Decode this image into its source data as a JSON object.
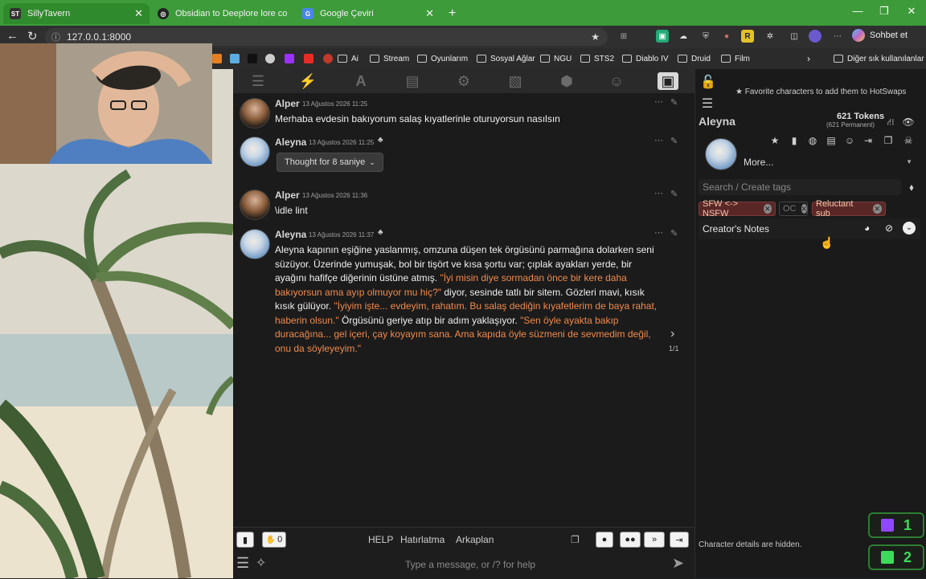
{
  "browser": {
    "tabs": [
      {
        "title": "SillyTavern",
        "favicon": "ST",
        "active": true
      },
      {
        "title": "Obsidian to Deeplore lore convers",
        "favicon": "",
        "active": false
      },
      {
        "title": "Google Çeviri",
        "favicon": "",
        "active": false
      }
    ],
    "url": "127.0.0.1:8000",
    "copilot_label": "Sohbet et",
    "bookmarks": [
      "Ai",
      "Stream",
      "Oyunlarım",
      "Sosyal Ağlar",
      "NGU",
      "STS2",
      "Diablo IV",
      "Druid",
      "Film"
    ],
    "other_bookmarks": "Diğer sık kullanılanlar"
  },
  "chat": {
    "messages": [
      {
        "name": "Alper",
        "time": "13 Ağustos 2026 11:25",
        "text": "Merhaba evdesin bakıyorum salaş kıyatlerinle oturuyorsun nasılsın",
        "ai": false
      },
      {
        "name": "Aleyna",
        "time": "13 Ağustos 2026 11:25",
        "thought": "Thought for 8 saniye",
        "ai": true
      },
      {
        "name": "Alper",
        "time": "13 Ağustos 2026 11:36",
        "text": "\\idle lint",
        "ai": false
      },
      {
        "name": "Aleyna",
        "time": "13 Ağustos 2026 11:37",
        "ai": true,
        "segments": [
          {
            "t": "Aleyna kapının eşiğine yaslanmış, omzuna düşen tek örgüsünü parmağına dolarken seni süzüyor. Üzerinde yumuşak, bol bir tişört ve kısa şortu var; çıplak ayakları yerde, bir ayağını hafifçe diğerinin üstüne atmış. ",
            "q": false
          },
          {
            "t": "\"İyi misin diye sormadan önce bir kere daha bakıyorsun ama ayıp olmuyor mu hiç?\"",
            "q": true
          },
          {
            "t": " diyor, sesinde tatlı bir sitem. Gözleri mavi, kısık kısık gülüyor. ",
            "q": false
          },
          {
            "t": "\"İyiyim işte... evdeyim, rahatım. Bu salaş dediğin kıyafetlerim de baya rahat, haberin olsun.\"",
            "q": true
          },
          {
            "t": " Örgüsünü geriye atıp bir adım yaklaşıyor. ",
            "q": false
          },
          {
            "t": "\"Sen öyle ayakta bakıp duracağına... gel içeri, çay koyayım sana. Ama kapıda öyle süzmeni de sevmedim değil, onu da söyleyeyim.\"",
            "q": true
          }
        ],
        "swipe": "1/1"
      }
    ]
  },
  "bottom": {
    "bookmark_count": "0",
    "links": [
      "HELP",
      "Hatırlatma",
      "Arkaplan"
    ],
    "placeholder": "Type a message, or /? for help"
  },
  "character": {
    "hotswap_hint": "Favorite characters to add them to HotSwaps",
    "name": "Aleyna",
    "tokens": "621 Tokens",
    "permanent": "(621 Permanent)",
    "more": "More...",
    "tags_placeholder": "Search / Create tags",
    "tags": [
      "SFW <-> NSFW",
      "OC",
      "Reluctant sub"
    ],
    "creators_notes": "Creator's Notes",
    "details_hidden": "Character details are hidden."
  },
  "overlay": {
    "counters": [
      "1",
      "2"
    ]
  }
}
